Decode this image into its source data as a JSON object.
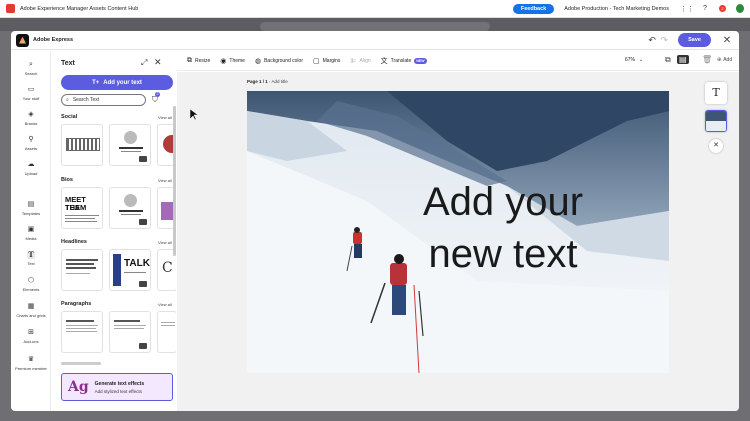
{
  "aem": {
    "title": "Adobe Experience Manager Assets Content Hub",
    "feedback_label": "Feedback",
    "org_label": "Adobe Production - Tech Marketing Demos",
    "notification_count": "2"
  },
  "modal": {
    "title": "Adobe Express",
    "save_label": "Save"
  },
  "rail": {
    "items": [
      {
        "label": "Search",
        "icon": "search-icon"
      },
      {
        "label": "Your stuff",
        "icon": "folder-icon"
      },
      {
        "label": "Brands",
        "icon": "brand-icon"
      },
      {
        "label": "Assets",
        "icon": "assets-icon"
      },
      {
        "label": "Upload",
        "icon": "upload-icon"
      },
      {
        "label": "Templates",
        "icon": "templates-icon"
      },
      {
        "label": "Media",
        "icon": "media-icon"
      },
      {
        "label": "Text",
        "icon": "text-icon"
      },
      {
        "label": "Elements",
        "icon": "elements-icon"
      },
      {
        "label": "Charts and grids",
        "icon": "charts-icon"
      },
      {
        "label": "Add-ons",
        "icon": "addons-icon"
      },
      {
        "label": "Premium member",
        "icon": "crown-icon"
      }
    ]
  },
  "panel": {
    "title": "Text",
    "add_text_label": "Add your text",
    "search_placeholder": "Search Text",
    "filter_count": "2",
    "sections": [
      {
        "label": "Social",
        "view_all": "View all"
      },
      {
        "label": "Bios",
        "view_all": "View all"
      },
      {
        "label": "Headlines",
        "view_all": "View all"
      },
      {
        "label": "Paragraphs",
        "view_all": "View all"
      }
    ],
    "thumb_text": {
      "meet_the_team_1": "MEET THE",
      "meet_the_team_2": "TEAM",
      "talk": "TALK"
    },
    "gen_effects": {
      "glyph": "Ag",
      "title": "Generate text effects",
      "subtitle": "Add stylized text effects"
    }
  },
  "toolbar": {
    "resize": "Resize",
    "theme": "Theme",
    "background_color": "Background color",
    "margins": "Margins",
    "align": "Align",
    "translate": "Translate",
    "new_badge": "NEW",
    "zoom": "67%",
    "add": "Add"
  },
  "canvas": {
    "page_label_bold": "Page 1 / 1",
    "page_label_rest": " - Add title",
    "text_line1": "Add your",
    "text_line2": "new text"
  }
}
